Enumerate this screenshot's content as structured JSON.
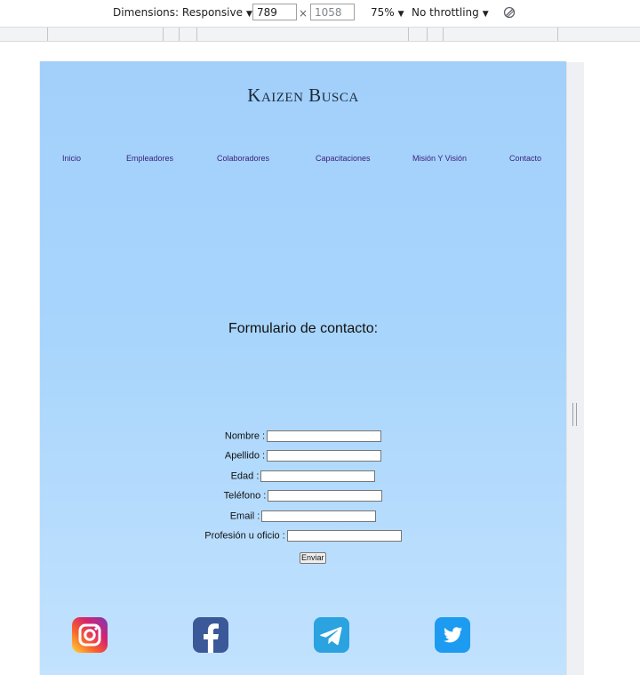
{
  "devtools": {
    "dimensions_label": "Dimensions: Responsive",
    "width": "789",
    "height": "1058",
    "times_symbol": "×",
    "zoom": "75%",
    "throttling": "No throttling"
  },
  "site": {
    "brand": "Kaizen Busca",
    "nav": [
      "Inicio",
      "Empleadores",
      "Colaboradores",
      "Capacitaciones",
      "Misión Y Visión",
      "Contacto"
    ],
    "form_title": "Formulario de contacto:",
    "form": {
      "fields": [
        {
          "label": "Nombre :"
        },
        {
          "label": "Apellido :"
        },
        {
          "label": "Edad :"
        },
        {
          "label": "Teléfono :"
        },
        {
          "label": "Email :"
        },
        {
          "label": "Profesión u oficio :"
        }
      ],
      "submit": "Enviar"
    },
    "social": [
      "instagram-icon",
      "facebook-icon",
      "telegram-icon",
      "twitter-icon"
    ],
    "social_colors": {
      "facebook": "#3b5998",
      "telegram": "#2aa3e0",
      "twitter": "#1d9bf0"
    }
  }
}
